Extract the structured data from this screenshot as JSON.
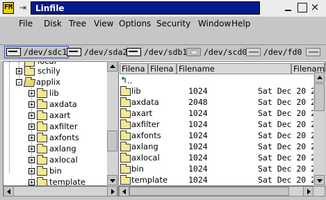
{
  "title_bar": {
    "title": "Linfile",
    "app_icon_text": "FM",
    "pin_icon": "pin-icon",
    "buttons": [
      "minimize-icon",
      "maximize-icon",
      "close-icon"
    ],
    "close_glyph": "×"
  },
  "menu": [
    "File",
    "Disk",
    "Tree",
    "View",
    "Options",
    "Security",
    "Window",
    "Help"
  ],
  "drives": [
    {
      "label": "/dev/sdc1",
      "icon": "hard-disk-icon",
      "selected": true
    },
    {
      "label": "/dev/sda2",
      "icon": "hard-disk-icon",
      "selected": false
    },
    {
      "label": "/dev/sdb1",
      "icon": "hard-disk-icon",
      "selected": false
    },
    {
      "label": "/dev/scd0",
      "icon": "cdrom-icon",
      "selected": false
    },
    {
      "label": "/dev/fd0",
      "icon": "floppy-icon",
      "selected": false
    },
    {
      "label": "",
      "icon": "floppy-icon",
      "selected": false
    }
  ],
  "tree": {
    "items": [
      {
        "label": "local",
        "expander": "+",
        "open": false
      },
      {
        "label": "schily",
        "expander": "+",
        "open": false
      },
      {
        "label": "applix",
        "expander": "-",
        "open": true
      },
      {
        "label": "lib",
        "expander": "+",
        "open": false
      },
      {
        "label": "axdata",
        "expander": "+",
        "open": false
      },
      {
        "label": "axart",
        "expander": "+",
        "open": false
      },
      {
        "label": "axfilter",
        "expander": "+",
        "open": false
      },
      {
        "label": "axfonts",
        "expander": "+",
        "open": false
      },
      {
        "label": "axlang",
        "expander": "+",
        "open": false
      },
      {
        "label": "axlocal",
        "expander": "+",
        "open": false
      },
      {
        "label": "bin",
        "expander": "+",
        "open": false
      },
      {
        "label": "template",
        "expander": "+",
        "open": false
      }
    ]
  },
  "file_list": {
    "headers": [
      "Filena",
      "Filena",
      "Filename",
      "Filenam"
    ],
    "up_glyph": "↰",
    "up_label": "..",
    "rows": [
      {
        "name": "lib",
        "size": "1024",
        "date": "Sat Dec 20 20"
      },
      {
        "name": "axdata",
        "size": "2048",
        "date": "Sat Dec 20 20"
      },
      {
        "name": "axart",
        "size": "1024",
        "date": "Sat Dec 20 20"
      },
      {
        "name": "axfilter",
        "size": "1024",
        "date": "Sat Dec 20 20"
      },
      {
        "name": "axfonts",
        "size": "1024",
        "date": "Sat Dec 20 20"
      },
      {
        "name": "axlang",
        "size": "1024",
        "date": "Sat Dec 20 20"
      },
      {
        "name": "axlocal",
        "size": "1024",
        "date": "Sat Dec 20 20"
      },
      {
        "name": "bin",
        "size": "1024",
        "date": "Sat Dec 20 20"
      },
      {
        "name": "template",
        "size": "1024",
        "date": "Sat Dec 20 20"
      }
    ]
  },
  "colors": {
    "title_bg": "#001a8c",
    "window_bg": "#c6c6c6",
    "folder": "#f5e890"
  }
}
